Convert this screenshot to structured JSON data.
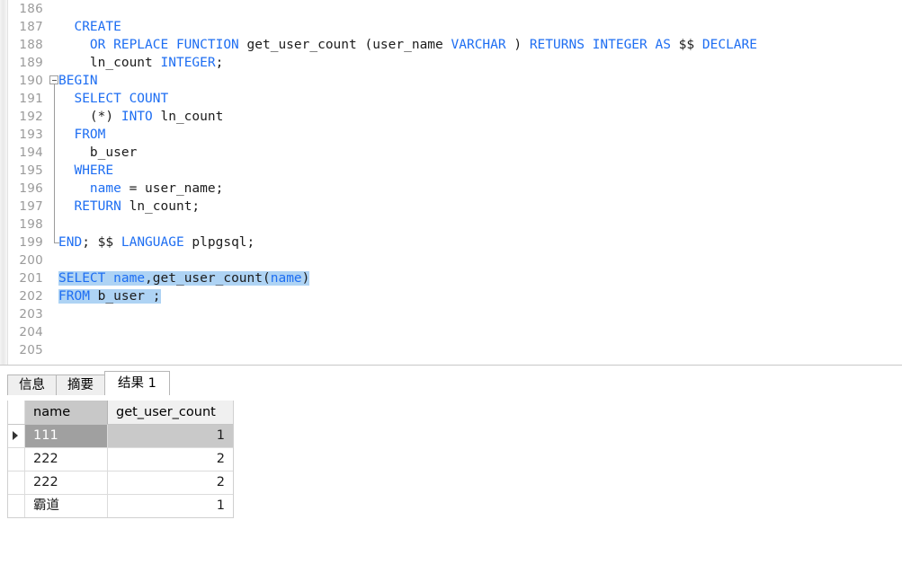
{
  "editor": {
    "first_visible_line": 186,
    "lines": [
      {
        "num": "186",
        "fold": "none",
        "tokens": []
      },
      {
        "num": "187",
        "fold": "none",
        "tokens": [
          {
            "t": "  ",
            "c": "plain"
          },
          {
            "t": "CREATE",
            "c": "kw"
          }
        ]
      },
      {
        "num": "188",
        "fold": "none",
        "tokens": [
          {
            "t": "    ",
            "c": "plain"
          },
          {
            "t": "OR REPLACE FUNCTION",
            "c": "kw"
          },
          {
            "t": " get_user_count (user_name ",
            "c": "plain"
          },
          {
            "t": "VARCHAR",
            "c": "kw"
          },
          {
            "t": " ) ",
            "c": "plain"
          },
          {
            "t": "RETURNS INTEGER AS",
            "c": "kw"
          },
          {
            "t": " $$ ",
            "c": "plain"
          },
          {
            "t": "DECLARE",
            "c": "kw"
          }
        ]
      },
      {
        "num": "189",
        "fold": "none",
        "tokens": [
          {
            "t": "    ln_count ",
            "c": "plain"
          },
          {
            "t": "INTEGER",
            "c": "kw"
          },
          {
            "t": ";",
            "c": "plain"
          }
        ]
      },
      {
        "num": "190",
        "fold": "start",
        "tokens": [
          {
            "t": "BEGIN",
            "c": "kw"
          }
        ]
      },
      {
        "num": "191",
        "fold": "through",
        "tokens": [
          {
            "t": "  ",
            "c": "plain"
          },
          {
            "t": "SELECT COUNT",
            "c": "kw"
          }
        ]
      },
      {
        "num": "192",
        "fold": "through",
        "tokens": [
          {
            "t": "    (*) ",
            "c": "plain"
          },
          {
            "t": "INTO",
            "c": "kw"
          },
          {
            "t": " ln_count",
            "c": "plain"
          }
        ]
      },
      {
        "num": "193",
        "fold": "through",
        "tokens": [
          {
            "t": "  ",
            "c": "plain"
          },
          {
            "t": "FROM",
            "c": "kw"
          }
        ]
      },
      {
        "num": "194",
        "fold": "through",
        "tokens": [
          {
            "t": "    b_user",
            "c": "plain"
          }
        ]
      },
      {
        "num": "195",
        "fold": "through",
        "tokens": [
          {
            "t": "  ",
            "c": "plain"
          },
          {
            "t": "WHERE",
            "c": "kw"
          }
        ]
      },
      {
        "num": "196",
        "fold": "through",
        "tokens": [
          {
            "t": "    ",
            "c": "plain"
          },
          {
            "t": "name",
            "c": "col"
          },
          {
            "t": " = user_name;",
            "c": "plain"
          }
        ]
      },
      {
        "num": "197",
        "fold": "through",
        "tokens": [
          {
            "t": "  ",
            "c": "plain"
          },
          {
            "t": "RETURN",
            "c": "kw"
          },
          {
            "t": " ln_count;",
            "c": "plain"
          }
        ]
      },
      {
        "num": "198",
        "fold": "through",
        "tokens": []
      },
      {
        "num": "199",
        "fold": "end",
        "tokens": [
          {
            "t": "END",
            "c": "kw"
          },
          {
            "t": "; $$ ",
            "c": "plain"
          },
          {
            "t": "LANGUAGE",
            "c": "kw"
          },
          {
            "t": " plpgsql;",
            "c": "plain"
          }
        ]
      },
      {
        "num": "200",
        "fold": "none",
        "tokens": []
      },
      {
        "num": "201",
        "fold": "none",
        "selected": true,
        "tokens": [
          {
            "t": "SELECT",
            "c": "kw"
          },
          {
            "t": " ",
            "c": "plain"
          },
          {
            "t": "name",
            "c": "col"
          },
          {
            "t": ",get_user_count(",
            "c": "plain"
          },
          {
            "t": "name",
            "c": "col"
          },
          {
            "t": ")",
            "c": "plain"
          }
        ]
      },
      {
        "num": "202",
        "fold": "none",
        "selected": true,
        "tokens": [
          {
            "t": "FROM",
            "c": "kw"
          },
          {
            "t": " b_user ;",
            "c": "plain"
          }
        ]
      },
      {
        "num": "203",
        "fold": "none",
        "tokens": []
      },
      {
        "num": "204",
        "fold": "none",
        "tokens": []
      },
      {
        "num": "205",
        "fold": "none",
        "tokens": []
      }
    ],
    "colors": {
      "keyword": "#1e6ef2",
      "column": "#1e6ef2",
      "plain": "#1c1c1c",
      "line_number": "#9a9a9a",
      "selection": "#aed3f4"
    }
  },
  "result_panel": {
    "tabs": [
      {
        "label": "信息",
        "active": false
      },
      {
        "label": "摘要",
        "active": false
      },
      {
        "label": "结果 1",
        "active": true
      }
    ],
    "grid": {
      "columns": [
        "name",
        "get_user_count"
      ],
      "rows": [
        {
          "name": "111",
          "get_user_count": "1",
          "selected": true
        },
        {
          "name": "222",
          "get_user_count": "2",
          "selected": false
        },
        {
          "name": "222",
          "get_user_count": "2",
          "selected": false
        },
        {
          "name": "霸道",
          "get_user_count": "1",
          "selected": false
        }
      ],
      "selected_row_index": 0,
      "selected_column": "name"
    }
  }
}
